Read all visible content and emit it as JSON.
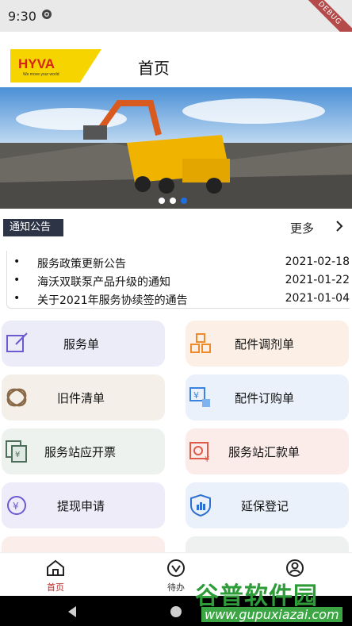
{
  "status_bar": {
    "time": "9:30",
    "debug_badge": "DEBUG"
  },
  "app_bar": {
    "title": "首页",
    "logo_text": "HYVA",
    "logo_tagline": "We move your world"
  },
  "banner": {
    "slides": 3,
    "active_index": 2
  },
  "notice": {
    "tag": "通知公告",
    "more_label": "更多",
    "items": [
      {
        "bullet": "•",
        "title": "服务政策更新公告",
        "date": "2021-02-18"
      },
      {
        "bullet": "•",
        "title": "海沃双联泵产品升级的通知",
        "date": "2021-01-22"
      },
      {
        "bullet": "•",
        "title": "关于2021年服务协续签的通告",
        "date": "2021-01-04"
      }
    ]
  },
  "cards": [
    {
      "label": "服务单",
      "icon": "edit-icon"
    },
    {
      "label": "配件调剂单",
      "icon": "cubes-icon"
    },
    {
      "label": "旧件清单",
      "icon": "ring-icon"
    },
    {
      "label": "配件订购单",
      "icon": "yen-boxes-icon"
    },
    {
      "label": "服务站应开票",
      "icon": "invoice-icon"
    },
    {
      "label": "服务站汇款单",
      "icon": "remit-icon"
    },
    {
      "label": "提现申请",
      "icon": "withdraw-icon"
    },
    {
      "label": "延保登记",
      "icon": "shield-chart-icon"
    }
  ],
  "bottom_nav": [
    {
      "label": "首页",
      "icon": "home-icon"
    },
    {
      "label": "待办",
      "icon": "todo-icon"
    },
    {
      "label": "",
      "icon": "profile-icon"
    }
  ],
  "watermark": {
    "brand": "谷普软件园",
    "url": "www.gupuxiazai.com"
  },
  "colors": {
    "accent": "#1e6fe0",
    "nav_active": "#b92b2b",
    "logo_yellow": "#f5d400",
    "logo_red": "#d8231c"
  }
}
